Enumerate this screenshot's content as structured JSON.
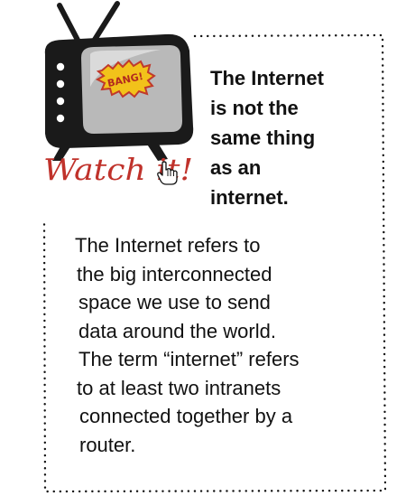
{
  "callout": {
    "badge": "BANG!",
    "caption": "Watch it!",
    "heading_lines": [
      "The Internet",
      "is not the",
      "same thing",
      "as an",
      "internet."
    ],
    "body_lines": [
      "The Internet refers to",
      "the big interconnected",
      "space we use to send",
      "data around the world.",
      "The term “internet” refers",
      "to at least two intranets",
      "connected together by a",
      "router."
    ]
  },
  "icons": [
    "retro-tv-icon",
    "hand-cursor-icon"
  ],
  "colors": {
    "tv_body": "#1a1a1a",
    "screen": "#b9b9b9",
    "badge_fill": "#f2c21a",
    "badge_outline": "#c0392b",
    "caption_red": "#c0322b",
    "dots": "#111111"
  }
}
